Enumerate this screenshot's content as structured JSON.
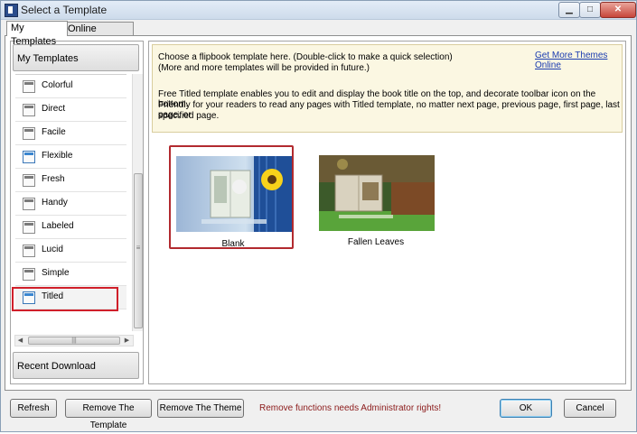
{
  "window": {
    "title": "Select a Template",
    "controls": {
      "minimize_icon": "minimize-icon",
      "maximize_icon": "maximize-icon",
      "close_icon": "close-icon"
    }
  },
  "tabs": [
    {
      "label": "My Templates",
      "active": true
    },
    {
      "label": "Online Templates",
      "active": false
    }
  ],
  "sidebar": {
    "group_top": "My Templates",
    "items": [
      {
        "label": "Colorful"
      },
      {
        "label": "Direct"
      },
      {
        "label": "Facile"
      },
      {
        "label": "Flexible"
      },
      {
        "label": "Fresh"
      },
      {
        "label": "Handy"
      },
      {
        "label": "Labeled"
      },
      {
        "label": "Lucid"
      },
      {
        "label": "Simple"
      },
      {
        "label": "Titled",
        "selected": true
      }
    ],
    "group_bottom": "Recent Download"
  },
  "info": {
    "line1": "Choose a flipbook template here. (Double-click to make a quick selection)",
    "line2": "(More and more templates will be provided in future.)",
    "line3": "Free Titled template enables you to edit and display the book title on the top, and decorate toolbar icon on the bottom.",
    "line4": "Friendly for your readers to read any pages with Titled template, no matter next page, previous page, first page, last page, or",
    "line5": "specified page.",
    "more_link": "Get More Themes Online"
  },
  "templates": [
    {
      "caption": "Blank",
      "selected": true
    },
    {
      "caption": "Fallen Leaves",
      "selected": false
    }
  ],
  "buttons": {
    "refresh": "Refresh",
    "remove_template": "Remove The Template",
    "remove_theme": "Remove The Theme",
    "ok": "OK",
    "cancel": "Cancel"
  },
  "warning": "Remove functions needs Administrator rights!",
  "colors": {
    "selection_border": "#d01f2a",
    "warning_text": "#8b1a1a",
    "link": "#1a3cb0",
    "info_bg": "#fbf7e2"
  }
}
